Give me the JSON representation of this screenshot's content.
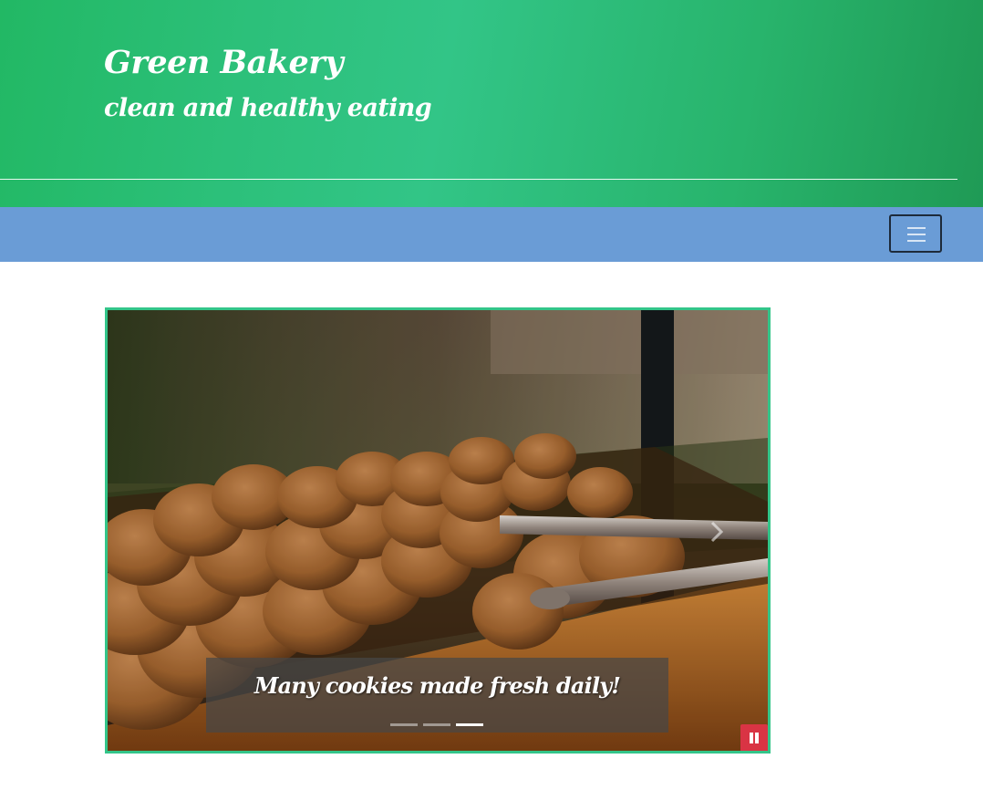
{
  "header": {
    "title": "Green Bakery",
    "tagline": "clean and healthy eating"
  },
  "navbar": {
    "toggle_icon": "hamburger-menu-icon"
  },
  "carousel": {
    "caption": "Many cookies made fresh daily!",
    "slides_count": 3,
    "active_slide": 3,
    "next_icon": "chevron-right-icon",
    "pause_icon": "pause-icon",
    "pause_color": "#d93444",
    "border_color": "#33c589"
  },
  "colors": {
    "header_green": "#2cc07a",
    "navbar_blue": "#6a9cd6"
  }
}
